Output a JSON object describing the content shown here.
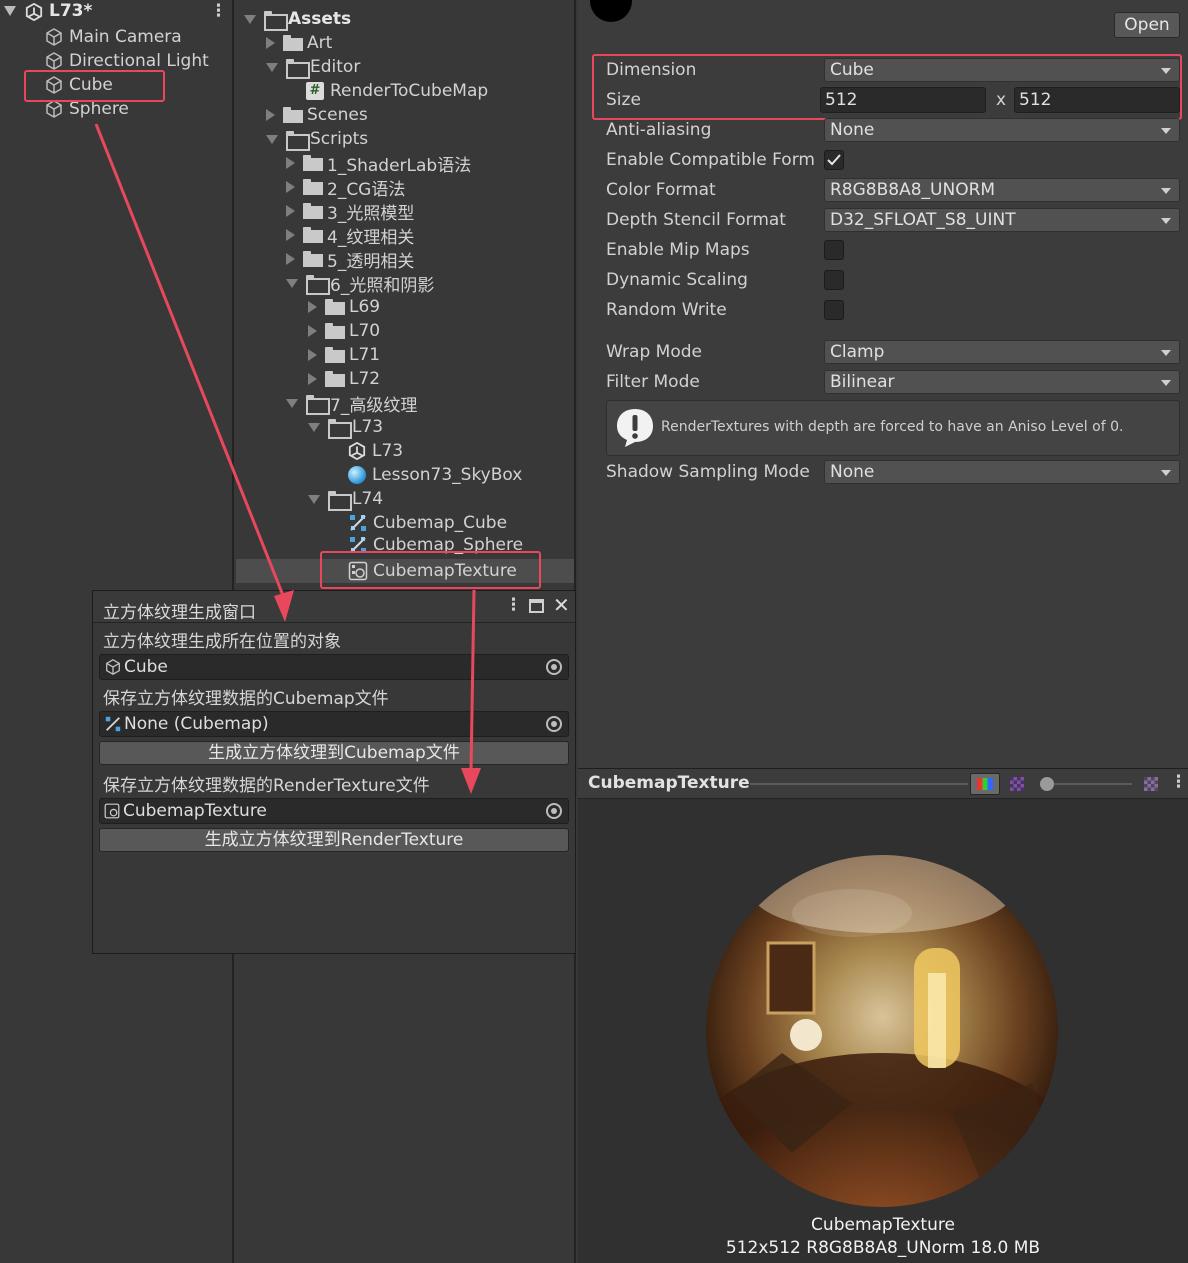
{
  "hierarchy": {
    "scene_title": "L73*",
    "items": [
      "Main Camera",
      "Directional Light",
      "Cube",
      "Sphere"
    ]
  },
  "project": {
    "root": "Assets",
    "items": [
      "Art",
      "Editor",
      "RenderToCubeMap",
      "Scenes",
      "Scripts",
      "1_ShaderLab语法",
      "2_CG语法",
      "3_光照模型",
      "4_纹理相关",
      "5_透明相关",
      "6_光照和阴影",
      "L69",
      "L70",
      "L71",
      "L72",
      "7_高级纹理",
      "L73",
      "L73",
      "Lesson73_SkyBox",
      "L74",
      "Cubemap_Cube",
      "Cubemap_Sphere",
      "CubemapTexture"
    ]
  },
  "inspector": {
    "open_label": "Open",
    "dimension_label": "Dimension",
    "dimension_value": "Cube",
    "size_label": "Size",
    "size_w": "512",
    "size_x": "x",
    "size_h": "512",
    "anti_aliasing_label": "Anti-aliasing",
    "anti_aliasing_value": "None",
    "enable_compat_label": "Enable Compatible Form",
    "color_format_label": "Color Format",
    "color_format_value": "R8G8B8A8_UNORM",
    "depth_stencil_label": "Depth Stencil Format",
    "depth_stencil_value": "D32_SFLOAT_S8_UINT",
    "mip_maps_label": "Enable Mip Maps",
    "dynamic_scaling_label": "Dynamic Scaling",
    "random_write_label": "Random Write",
    "wrap_mode_label": "Wrap Mode",
    "wrap_mode_value": "Clamp",
    "filter_mode_label": "Filter Mode",
    "filter_mode_value": "Bilinear",
    "help_text": "RenderTextures with depth are forced to have an Aniso Level of 0.",
    "shadow_label": "Shadow Sampling Mode",
    "shadow_value": "None"
  },
  "preview": {
    "title": "CubemapTexture",
    "caption_name": "CubemapTexture",
    "caption_info": "512x512  R8G8B8A8_UNorm  18.0 MB"
  },
  "window": {
    "tab_title": "立方体纹理生成窗口",
    "target_label": "立方体纹理生成所在位置的对象",
    "target_value": "Cube",
    "cubemap_label": "保存立方体纹理数据的Cubemap文件",
    "cubemap_value": "None (Cubemap)",
    "cubemap_button": "生成立方体纹理到Cubemap文件",
    "rt_label": "保存立方体纹理数据的RenderTexture文件",
    "rt_value": "CubemapTexture",
    "rt_button": "生成立方体纹理到RenderTexture"
  },
  "colors": {
    "highlight": "#e8485d",
    "panel": "#383838",
    "field": "#2a2a2a"
  }
}
